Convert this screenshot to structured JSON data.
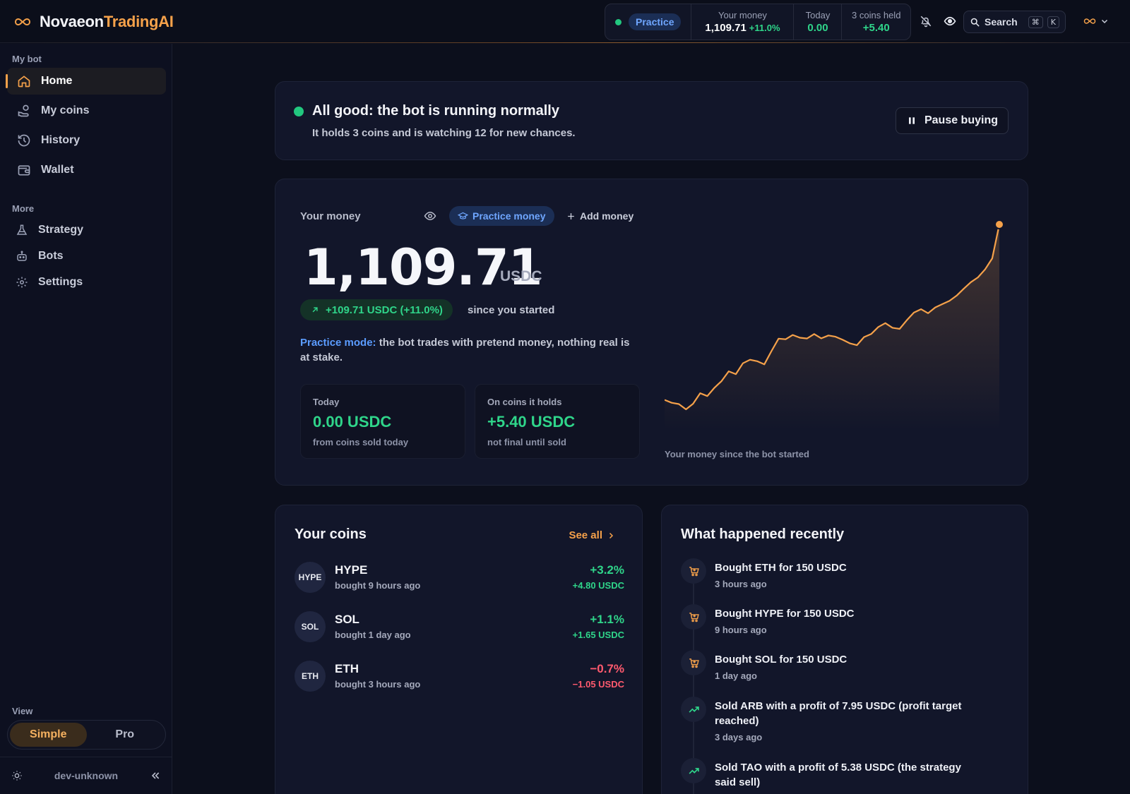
{
  "brand": {
    "name_a": "Novaeon",
    "name_b": "TradingAI"
  },
  "topbar": {
    "mode_pill": "Practice",
    "stats": [
      {
        "label": "Your money",
        "value": "1,109.71",
        "change": "+11.0%"
      },
      {
        "label": "Today",
        "value": "0.00"
      },
      {
        "label": "3 coins held",
        "value": "+5.40"
      }
    ],
    "search_label": "Search",
    "kbd_cmd": "⌘",
    "kbd_key": "K"
  },
  "sidebar": {
    "section_mybot": "My bot",
    "section_more": "More",
    "items": [
      {
        "label": "Home",
        "icon": "home-icon",
        "active": true
      },
      {
        "label": "My coins",
        "icon": "coins-icon"
      },
      {
        "label": "History",
        "icon": "history-icon"
      },
      {
        "label": "Wallet",
        "icon": "wallet-icon"
      },
      {
        "label": "Strategy",
        "icon": "flask-icon"
      },
      {
        "label": "Bots",
        "icon": "robot-icon"
      },
      {
        "label": "Settings",
        "icon": "gear-icon"
      }
    ],
    "view_label": "View",
    "view_options": [
      "Simple",
      "Pro"
    ],
    "view_selected": "Simple",
    "footer_label": "dev-unknown"
  },
  "status": {
    "title": "All good: the bot is running normally",
    "subtitle": "It holds 3 coins and is watching 12 for new chances.",
    "pause_label": "Pause buying"
  },
  "money": {
    "label": "Your money",
    "practice_pill": "Practice money",
    "add_money": "Add money",
    "amount": "1,109.71",
    "unit": "USDC",
    "gain": "+109.71 USDC (+11.0%)",
    "since": "since you started",
    "note_strong": "Practice mode:",
    "note_rest": " the bot trades with pretend money, nothing real is at stake.",
    "today": {
      "label": "Today",
      "value": "0.00 USDC",
      "sub": "from coins sold today"
    },
    "holds": {
      "label": "On coins it holds",
      "value": "+5.40 USDC",
      "sub": "not final until sold"
    },
    "chart_caption": "Your money since the bot started"
  },
  "chart_data": {
    "type": "area",
    "title": "",
    "xlabel": "",
    "ylabel": "",
    "color": "#f5a14a",
    "values": [
      1000.0,
      998.2,
      997.4,
      994.1,
      997.6,
      1004.2,
      1002.4,
      1007.6,
      1011.8,
      1017.9,
      1016.1,
      1022.9,
      1025.1,
      1024.2,
      1022.2,
      1030.5,
      1038.3,
      1037.9,
      1040.6,
      1038.9,
      1038.4,
      1041.2,
      1038.5,
      1040.3,
      1039.5,
      1037.6,
      1035.4,
      1034.2,
      1039.3,
      1041.2,
      1045.6,
      1048.0,
      1045.1,
      1044.4,
      1049.8,
      1054.6,
      1056.7,
      1054.2,
      1057.8,
      1059.9,
      1061.9,
      1065.2,
      1069.5,
      1073.6,
      1076.6,
      1081.6,
      1088.5,
      1109.71
    ]
  },
  "coins": {
    "title": "Your coins",
    "see_all": "See all",
    "rows": [
      {
        "symbol": "HYPE",
        "name": "HYPE",
        "when": "bought 9 hours ago",
        "pct": "+3.2%",
        "usd": "+4.80 USDC",
        "dir": "up"
      },
      {
        "symbol": "SOL",
        "name": "SOL",
        "when": "bought 1 day ago",
        "pct": "+1.1%",
        "usd": "+1.65 USDC",
        "dir": "up"
      },
      {
        "symbol": "ETH",
        "name": "ETH",
        "when": "bought 3 hours ago",
        "pct": "−0.7%",
        "usd": "−1.05 USDC",
        "dir": "down"
      }
    ]
  },
  "recent": {
    "title": "What happened recently",
    "events": [
      {
        "icon": "cart-icon",
        "text": "Bought ETH for 150 USDC",
        "time": "3 hours ago"
      },
      {
        "icon": "cart-icon",
        "text": "Bought HYPE for 150 USDC",
        "time": "9 hours ago"
      },
      {
        "icon": "cart-icon",
        "text": "Bought SOL for 150 USDC",
        "time": "1 day ago"
      },
      {
        "icon": "trend-up-icon",
        "text": "Sold ARB with a profit of 7.95 USDC (profit target reached)",
        "time": "3 days ago"
      },
      {
        "icon": "trend-up-icon",
        "text": "Sold TAO with a profit of 5.38 USDC (the strategy said sell)",
        "time": ""
      }
    ]
  }
}
